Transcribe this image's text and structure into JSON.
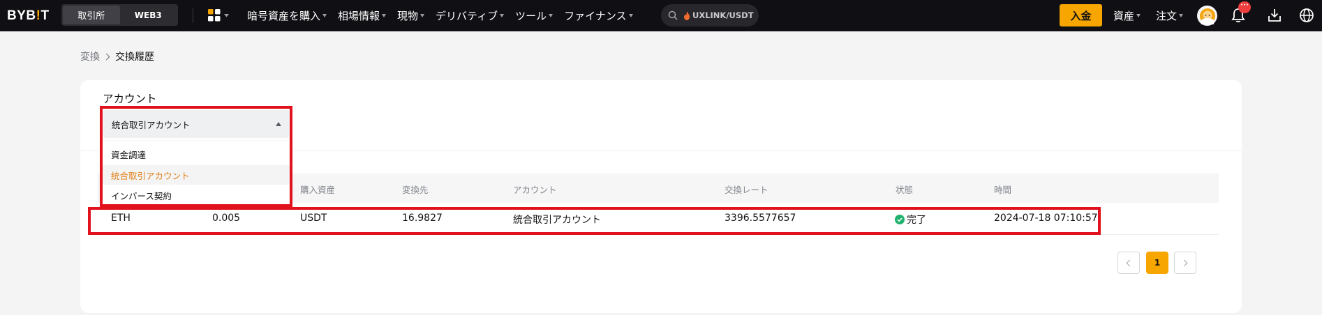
{
  "nav": {
    "logo": {
      "main": "BYB",
      "accent": "!",
      "tail": "T"
    },
    "mode_tabs": [
      "取引所",
      "WEB3"
    ],
    "menu_items": [
      "暗号資産を購入",
      "相場情報",
      "現物",
      "デリバティブ",
      "ツール",
      "ファイナンス"
    ],
    "search_text": "UXLINK/USDT",
    "deposit_label": "入金",
    "right_items": [
      "資産",
      "注文"
    ],
    "notification_badge": "···",
    "brand_color": "#f7a600"
  },
  "breadcrumb": {
    "parent": "変換",
    "current": "交換履歴"
  },
  "filter": {
    "label": "アカウント",
    "selected": "統合取引アカウント",
    "options": [
      "資金調達",
      "統合取引アカウント",
      "インバース契約"
    ]
  },
  "table": {
    "columns": [
      "",
      "",
      "購入資産",
      "変換先",
      "アカウント",
      "交換レート",
      "状態",
      "時間"
    ],
    "rows": [
      {
        "from_coin": "ETH",
        "amount": "0.005",
        "buy_asset": "USDT",
        "to_amount": "16.9827",
        "account": "統合取引アカウント",
        "rate": "3396.5577657",
        "status": "完了",
        "time": "2024-07-18 07:10:57"
      }
    ]
  },
  "pagination": {
    "current_page": "1"
  }
}
